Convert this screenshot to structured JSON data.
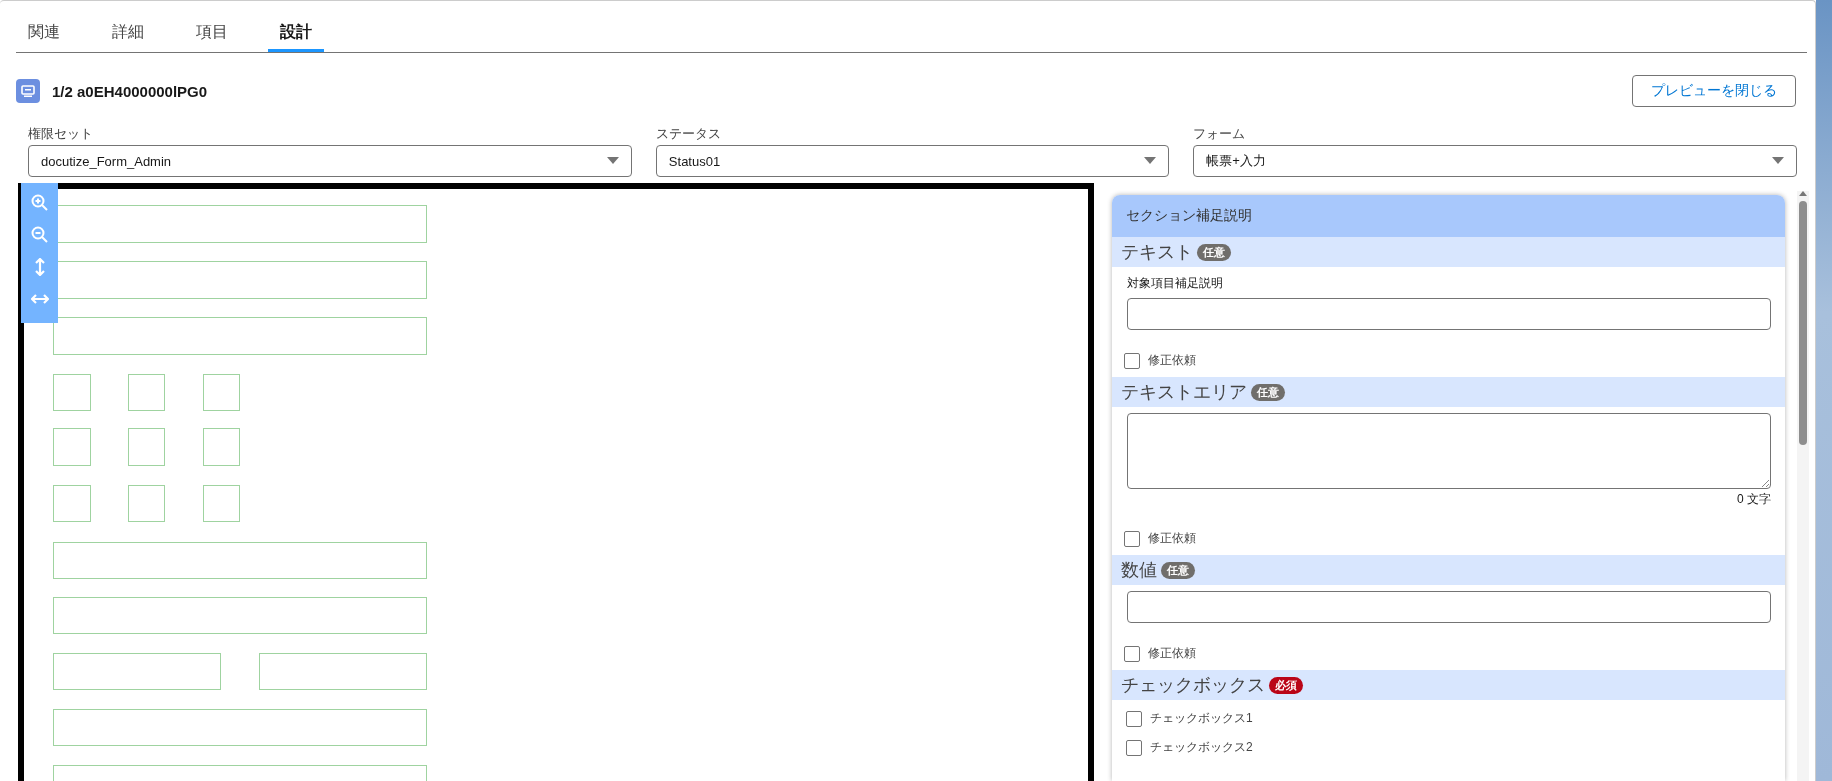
{
  "tabs": [
    {
      "label": "関連",
      "selected": false
    },
    {
      "label": "詳細",
      "selected": false
    },
    {
      "label": "項目",
      "selected": false
    },
    {
      "label": "設計",
      "selected": true
    }
  ],
  "record": {
    "title": "1/2 a0EH4000000lPG0"
  },
  "close_button": "プレビューを閉じる",
  "filters": [
    {
      "label": "権限セット",
      "value": "docutize_Form_Admin"
    },
    {
      "label": "ステータス",
      "value": "Status01"
    },
    {
      "label": "フォーム",
      "value": "帳票+入力"
    }
  ],
  "panel": {
    "title": "セクション補足説明",
    "sections": [
      {
        "kind": "text",
        "title": "テキスト",
        "badge": "任意",
        "required": false,
        "field_label": "対象項目補足説明",
        "checkbox": {
          "label": "修正依頼",
          "checked": false
        }
      },
      {
        "kind": "textarea",
        "title": "テキストエリア",
        "badge": "任意",
        "required": false,
        "counter": "0 文字",
        "checkbox": {
          "label": "修正依頼",
          "checked": false
        }
      },
      {
        "kind": "number",
        "title": "数値",
        "badge": "任意",
        "required": false,
        "checkbox": {
          "label": "修正依頼",
          "checked": false
        }
      },
      {
        "kind": "checkboxes",
        "title": "チェックボックス",
        "badge": "必須",
        "required": true,
        "options": [
          {
            "label": "チェックボックス1",
            "checked": false
          },
          {
            "label": "チェックボックス2",
            "checked": false
          }
        ]
      }
    ]
  }
}
